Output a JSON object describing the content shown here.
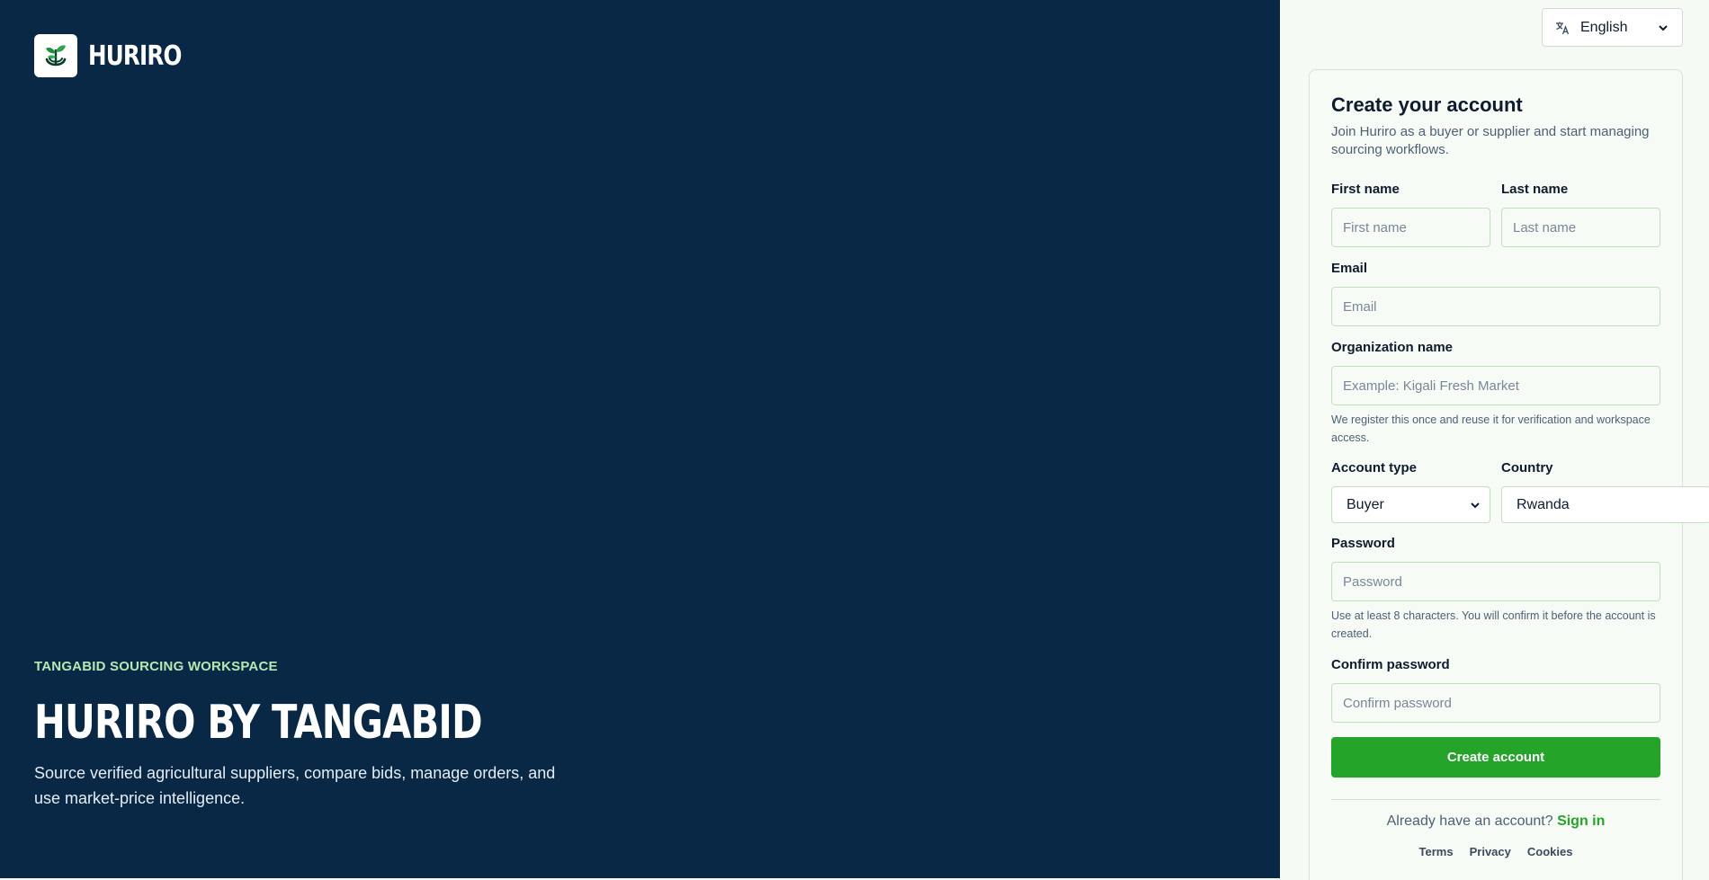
{
  "brand": {
    "name": "HURIRO",
    "logo_icon": "sprout-leaf-icon"
  },
  "hero": {
    "eyebrow": "TANGABID SOURCING WORKSPACE",
    "title": "HURIRO BY TANGABID",
    "description": "Source verified agricultural suppliers, compare bids, manage orders, and use market-price intelligence."
  },
  "language": {
    "icon": "translate-icon",
    "selected": "English"
  },
  "form": {
    "title": "Create your account",
    "subtitle": "Join Huriro as a buyer or supplier and start managing sourcing workflows.",
    "first_name": {
      "label": "First name",
      "placeholder": "First name",
      "value": ""
    },
    "last_name": {
      "label": "Last name",
      "placeholder": "Last name",
      "value": ""
    },
    "email": {
      "label": "Email",
      "placeholder": "Email",
      "value": ""
    },
    "organization": {
      "label": "Organization name",
      "placeholder": "Example: Kigali Fresh Market",
      "value": "",
      "help": "We register this once and reuse it for verification and workspace access."
    },
    "account_type": {
      "label": "Account type",
      "selected": "Buyer"
    },
    "country": {
      "label": "Country",
      "selected": "Rwanda"
    },
    "password": {
      "label": "Password",
      "placeholder": "Password",
      "value": "",
      "help": "Use at least 8 characters. You will confirm it before the account is created."
    },
    "confirm_password": {
      "label": "Confirm password",
      "placeholder": "Confirm password",
      "value": ""
    },
    "submit_label": "Create account",
    "signin_prompt": "Already have an account?",
    "signin_link": "Sign in",
    "footer_links": [
      "Terms",
      "Privacy",
      "Cookies"
    ]
  },
  "colors": {
    "sidebar_bg": "#082846",
    "accent_green": "#25a42a",
    "eyebrow_green": "#b7e8b2",
    "page_bg": "#f6faf5"
  }
}
